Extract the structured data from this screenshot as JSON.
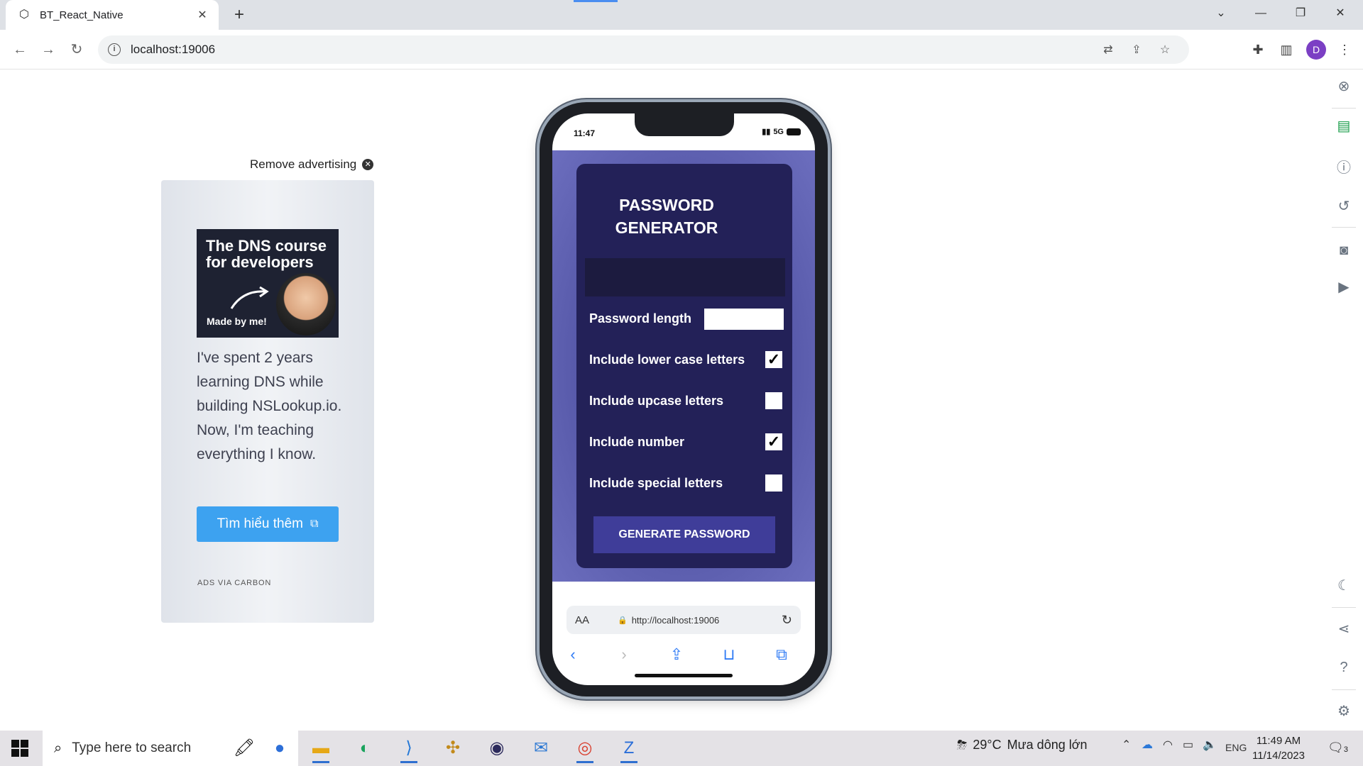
{
  "browser": {
    "tab_title": "BT_React_Native",
    "tab_close": "✕",
    "new_tab": "+",
    "url": "localhost:19006",
    "avatar_letter": "D",
    "win_minimize": "—",
    "win_restore": "❐",
    "win_close": "✕",
    "win_dropdown": "⌄"
  },
  "ad": {
    "remove_label": "Remove advertising",
    "image_headline": "The DNS course for developers",
    "image_caption": "Made by me!",
    "body_text": "I've spent 2 years learning DNS while building NSLookup.io. Now, I'm teaching everything I know.",
    "button_label": "Tìm hiểu thêm",
    "footer": "ADS VIA CARBON"
  },
  "phone": {
    "time": "11:47",
    "network": "5G",
    "app": {
      "title": "PASSWORD GENERATOR",
      "password_output": "",
      "length_label": "Password length",
      "length_value": "",
      "options": [
        {
          "label": "Include lower case letters",
          "checked": true,
          "mark": "✓"
        },
        {
          "label": "Include upcase letters",
          "checked": false,
          "mark": ""
        },
        {
          "label": "Include number",
          "checked": true,
          "mark": "✓"
        },
        {
          "label": "Include special letters",
          "checked": false,
          "mark": ""
        }
      ],
      "generate_button": "GENERATE PASSWORD"
    },
    "safari": {
      "aa": "AA",
      "url": "http://localhost:19006"
    }
  },
  "taskbar": {
    "search_placeholder": "Type here to search",
    "weather_temp": "29°C",
    "weather_desc": "Mưa dông lớn",
    "language": "ENG",
    "time": "11:49 AM",
    "date": "11/14/2023",
    "notification_count": "3"
  },
  "colors": {
    "app_card": "#232158",
    "app_bg": "#5e60b0",
    "button": "#3f3d99",
    "ad_button": "#3da2f0"
  }
}
